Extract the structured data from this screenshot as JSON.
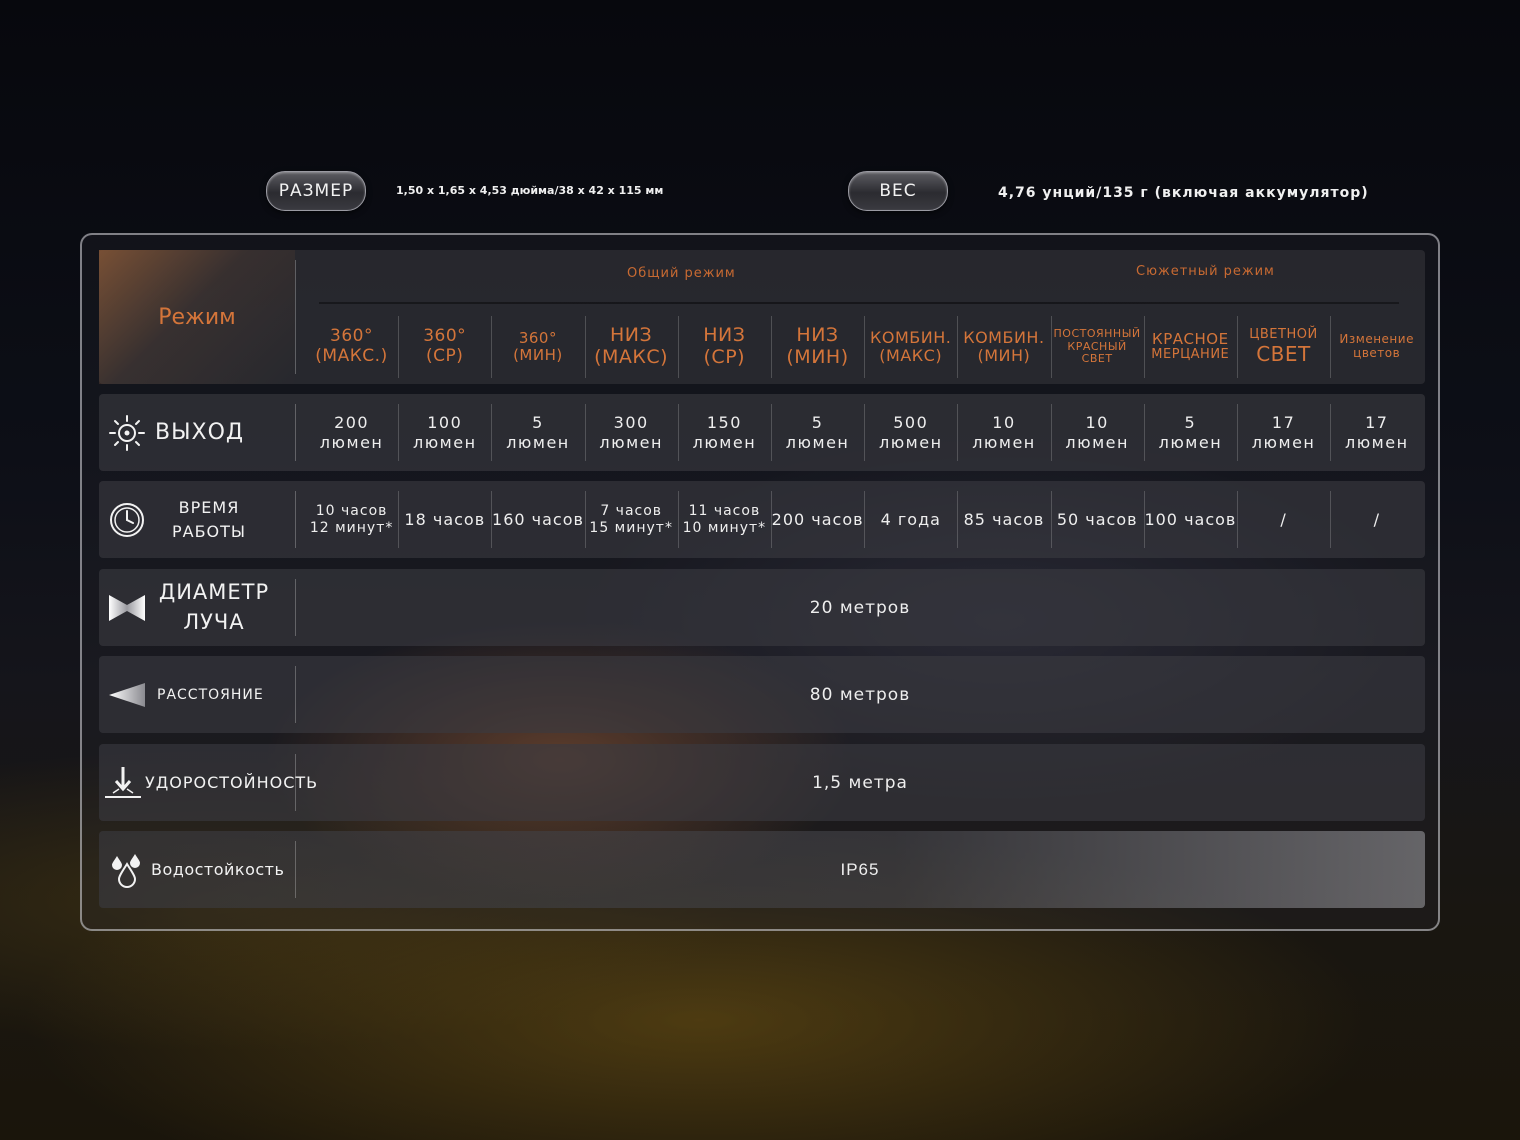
{
  "size": {
    "label": "РАЗМЕР",
    "value": "1,50 x 1,65 x 4,53 дюйма/38 x 42 x 115 мм"
  },
  "weight": {
    "label": "ВЕС",
    "value": "4,76 унций/135 г (включая аккумулятор)"
  },
  "table": {
    "mode_label": "Режим",
    "groups": {
      "general": "Общий режим",
      "scene": "Сюжетный режим"
    },
    "columns": [
      [
        "360°",
        "(МАКС.)"
      ],
      [
        "360°",
        "(СР)"
      ],
      [
        "360°",
        "(МИН)"
      ],
      [
        "НИЗ",
        "(МАКС)"
      ],
      [
        "НИЗ",
        "(СР)"
      ],
      [
        "НИЗ",
        "(МИН)"
      ],
      [
        "КОМБИН.",
        "(МАКС)"
      ],
      [
        "КОМБИН.",
        "(МИН)"
      ],
      [
        "ПОСТОЯННЫЙ",
        "КРАСНЫЙ",
        "СВЕТ"
      ],
      [
        "КРАСНОЕ",
        "МЕРЦАНИЕ"
      ],
      [
        "ЦВЕТНОЙ",
        "СВЕТ"
      ],
      [
        "Изменение",
        "цветов"
      ]
    ],
    "output": {
      "label": "ВЫХОД",
      "values": [
        [
          "200",
          "люмен"
        ],
        [
          "100",
          "люмен"
        ],
        [
          "5",
          "люмен"
        ],
        [
          "300",
          "люмен"
        ],
        [
          "150",
          "люмен"
        ],
        [
          "5",
          "люмен"
        ],
        [
          "500",
          "люмен"
        ],
        [
          "10",
          "люмен"
        ],
        [
          "10",
          "люмен"
        ],
        [
          "5",
          "люмен"
        ],
        [
          "17",
          "люмен"
        ],
        [
          "17",
          "люмен"
        ]
      ]
    },
    "runtime": {
      "label_line1": "ВРЕМЯ",
      "label_line2": "РАБОТЫ",
      "values": [
        [
          "10 часов",
          "12 минут*"
        ],
        [
          "18 часов"
        ],
        [
          "160 часов"
        ],
        [
          "7 часов",
          "15 минут*"
        ],
        [
          "11 часов",
          "10 минут*"
        ],
        [
          "200 часов"
        ],
        [
          "4 года"
        ],
        [
          "85 часов"
        ],
        [
          "50 часов"
        ],
        [
          "100 часов"
        ],
        [
          "/"
        ],
        [
          "/"
        ]
      ]
    },
    "beam": {
      "label_line1": "ДИАМЕТР",
      "label_line2": "ЛУЧА",
      "value": "20 метров"
    },
    "distance": {
      "label": "РАССТОЯНИЕ",
      "value": "80 метров"
    },
    "impact": {
      "label": "УДОРОСТОЙНОСТЬ",
      "value": "1,5 метра"
    },
    "water": {
      "label": "Водостойкость",
      "value": "IP65"
    }
  },
  "icons": {
    "output": "sun-icon",
    "runtime": "clock-icon",
    "beam": "beam-angle-icon",
    "distance": "distance-cone-icon",
    "impact": "drop-impact-icon",
    "water": "water-drops-icon"
  },
  "colors": {
    "accent": "#d4753a",
    "text": "#eeeeee"
  }
}
